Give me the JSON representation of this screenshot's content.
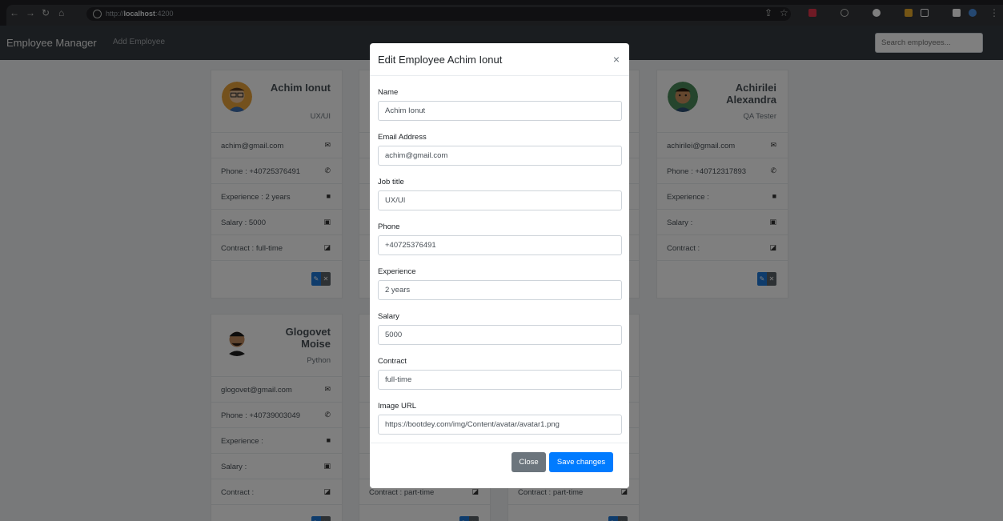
{
  "browser": {
    "url_prefix": "http://",
    "url_host": "localhost",
    "url_suffix": ":4200"
  },
  "navbar": {
    "brand": "Employee Manager",
    "add_link": "Add Employee",
    "search_placeholder": "Search employees..."
  },
  "cards": [
    {
      "name": "Achim Ionut",
      "role": "UX/UI",
      "email": "achim@gmail.com",
      "phone": "Phone : +40725376491",
      "experience": "Experience : 2 years",
      "salary": "Salary : 5000",
      "contract": "Contract : full-time"
    },
    {
      "name": "Achirilei Alexandra",
      "role": "QA Tester",
      "email": "achirilei@gmail.com",
      "phone": "Phone : +40712317893",
      "experience": "Experience :",
      "salary": "Salary :",
      "contract": "Contract :"
    },
    {
      "name": "Glogovet Moise",
      "role": "Python",
      "email": "glogovet@gmail.com",
      "phone": "Phone : +40739003049",
      "experience": "Experience :",
      "salary": "Salary :",
      "contract": "Contract :"
    }
  ],
  "partial_rows": {
    "contract_b": "Contract : part-time",
    "contract_c": "Contract : part-time"
  },
  "icons": {
    "email": "envelope-icon",
    "phone": "phone-icon",
    "experience": "briefcase-icon",
    "salary": "money-icon",
    "contract": "pen-square-icon",
    "edit": "pencil-icon",
    "delete": "times-icon"
  },
  "modal": {
    "title": "Edit Employee Achim Ionut",
    "close_glyph": "×",
    "fields": [
      {
        "label": "Name",
        "value": "Achim Ionut"
      },
      {
        "label": "Email Address",
        "value": "achim@gmail.com"
      },
      {
        "label": "Job title",
        "value": "UX/UI"
      },
      {
        "label": "Phone",
        "value": "+40725376491"
      },
      {
        "label": "Experience",
        "value": "2 years"
      },
      {
        "label": "Salary",
        "value": "5000"
      },
      {
        "label": "Contract",
        "value": "full-time"
      },
      {
        "label": "Image URL",
        "value": "https://bootdey.com/img/Content/avatar/avatar1.png"
      }
    ],
    "close_button": "Close",
    "save_button": "Save changes"
  },
  "colors": {
    "primary": "#007bff",
    "secondary": "#6c757d",
    "navbar": "#343a40"
  }
}
